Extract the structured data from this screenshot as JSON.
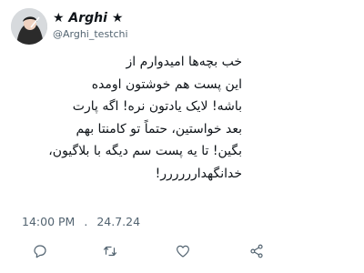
{
  "tweet": {
    "author": {
      "display_name": "★ Arghi ★",
      "handle": "@Arghi_testchi"
    },
    "lines": [
      "خب بچه‌ها امیدوارم از",
      "این پست هم خوشتون اومده",
      "باشه! لایک یادتون نره! اگه پارت",
      "بعد خواستین، حتماً تو کامنتا بهم",
      "بگین! تا یه پست سم دیگه با بلاگیون،",
      "خدانگهدارررررر!"
    ],
    "time": "14:00 PM",
    "separator": ".",
    "date": "24.7.24"
  },
  "actions": [
    {
      "name": "reply",
      "icon": "comment-icon"
    },
    {
      "name": "retweet",
      "icon": "retweet-icon"
    },
    {
      "name": "like",
      "icon": "heart-icon"
    },
    {
      "name": "share",
      "icon": "share-icon"
    }
  ],
  "colors": {
    "text": "#0f1419",
    "secondary": "#536471"
  }
}
